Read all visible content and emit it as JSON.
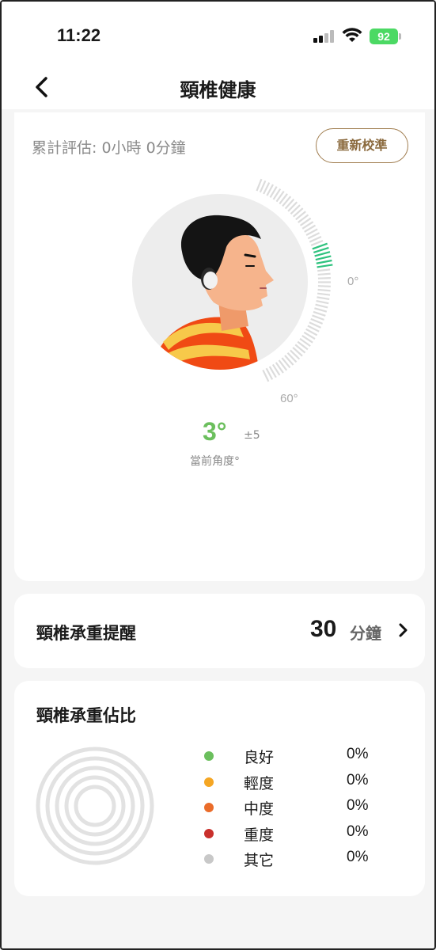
{
  "status_bar": {
    "time": "11:22",
    "battery": "92"
  },
  "header": {
    "title": "頸椎健康"
  },
  "assessment": {
    "cumulative": "累計評估: 0小時 0分鐘",
    "recalibrate_label": "重新校準",
    "scale_top": "0°",
    "scale_bottom": "60°",
    "current_angle": "3°",
    "tolerance": "±5",
    "current_angle_label": "當前角度°"
  },
  "reminder": {
    "label": "頸椎承重提醒",
    "value": "30",
    "unit": "分鐘"
  },
  "ratio": {
    "title": "頸椎承重佔比",
    "items": [
      {
        "name": "良好",
        "pct": "0%",
        "color": "#6bbf5d"
      },
      {
        "name": "輕度",
        "pct": "0%",
        "color": "#f5a623"
      },
      {
        "name": "中度",
        "pct": "0%",
        "color": "#ea6c2a"
      },
      {
        "name": "重度",
        "pct": "0%",
        "color": "#c9302c"
      },
      {
        "name": "其它",
        "pct": "0%",
        "color": "#c8c8c8"
      }
    ]
  },
  "icons": [
    "back-icon",
    "chevron-right-icon",
    "signal-icon",
    "wifi-icon",
    "battery-icon"
  ]
}
